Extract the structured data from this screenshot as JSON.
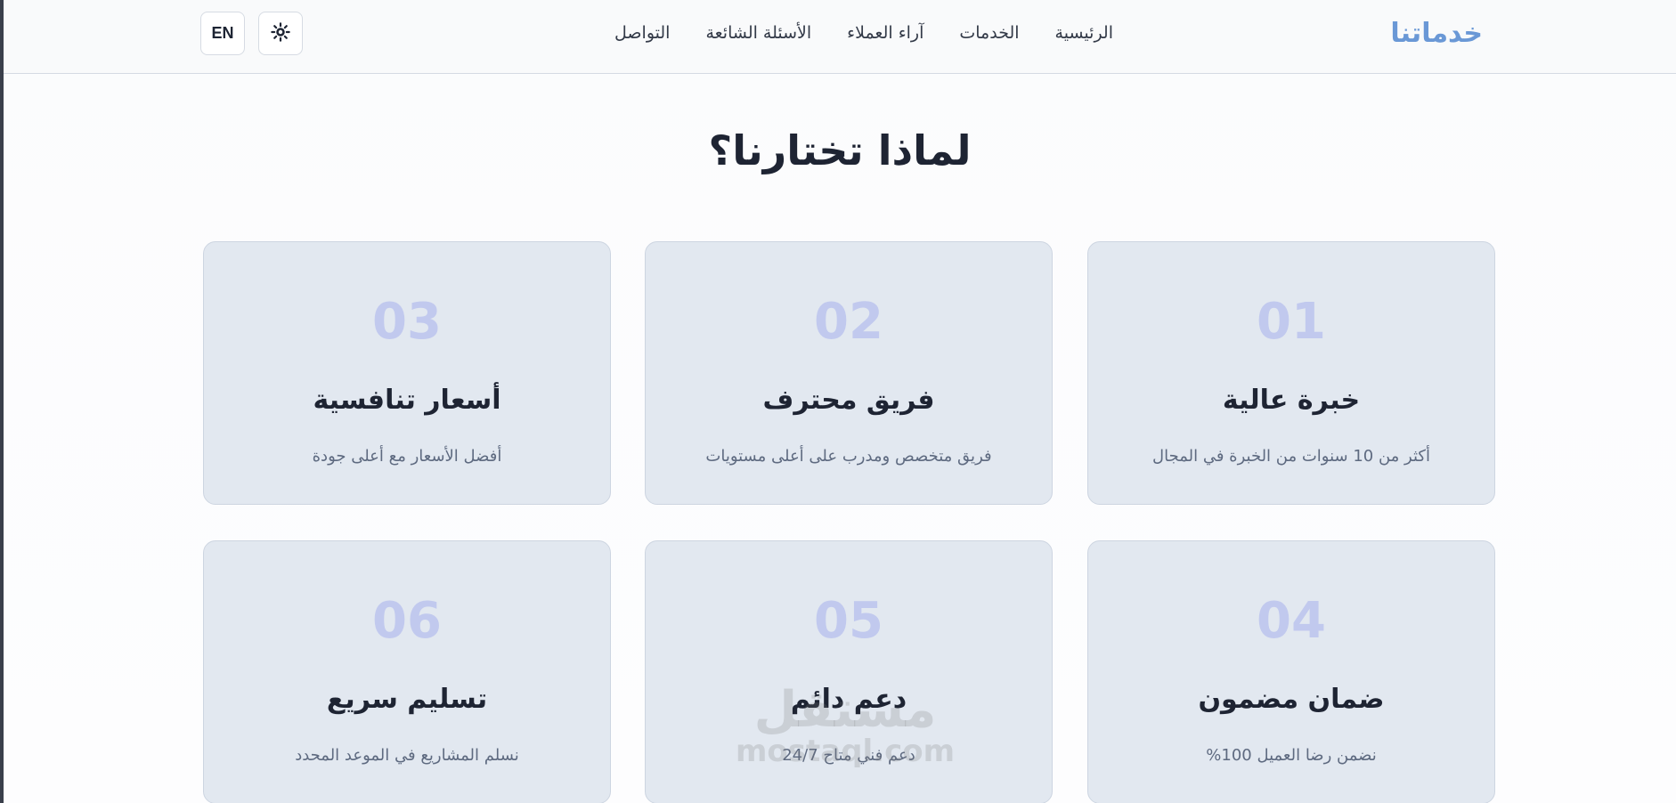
{
  "header": {
    "logo": "خدماتنا",
    "nav": [
      "الرئيسية",
      "الخدمات",
      "آراء العملاء",
      "الأسئلة الشائعة",
      "التواصل"
    ],
    "lang_button": "EN",
    "theme_icon": "sun-icon"
  },
  "section": {
    "title": "لماذا تختارنا؟",
    "cards": [
      {
        "number": "01",
        "title": "خبرة عالية",
        "description": "أكثر من 10 سنوات من الخبرة في المجال"
      },
      {
        "number": "02",
        "title": "فريق محترف",
        "description": "فريق متخصص ومدرب على أعلى مستويات"
      },
      {
        "number": "03",
        "title": "أسعار تنافسية",
        "description": "أفضل الأسعار مع أعلى جودة"
      },
      {
        "number": "04",
        "title": "ضمان مضمون",
        "description": "نضمن رضا العميل 100%"
      },
      {
        "number": "05",
        "title": "دعم دائم",
        "description": "دعم فني متاح 24/7"
      },
      {
        "number": "06",
        "title": "تسليم سريع",
        "description": "نسلم المشاريع في الموعد المحدد"
      }
    ]
  },
  "watermark": {
    "arabic": "مستقل",
    "latin": "mostaql.com"
  },
  "colors": {
    "logo": "#6a98d6",
    "card_bg": "#e2e8f0",
    "number": "#c1c9ee",
    "title": "#1e2433",
    "description": "#5e6a80"
  }
}
